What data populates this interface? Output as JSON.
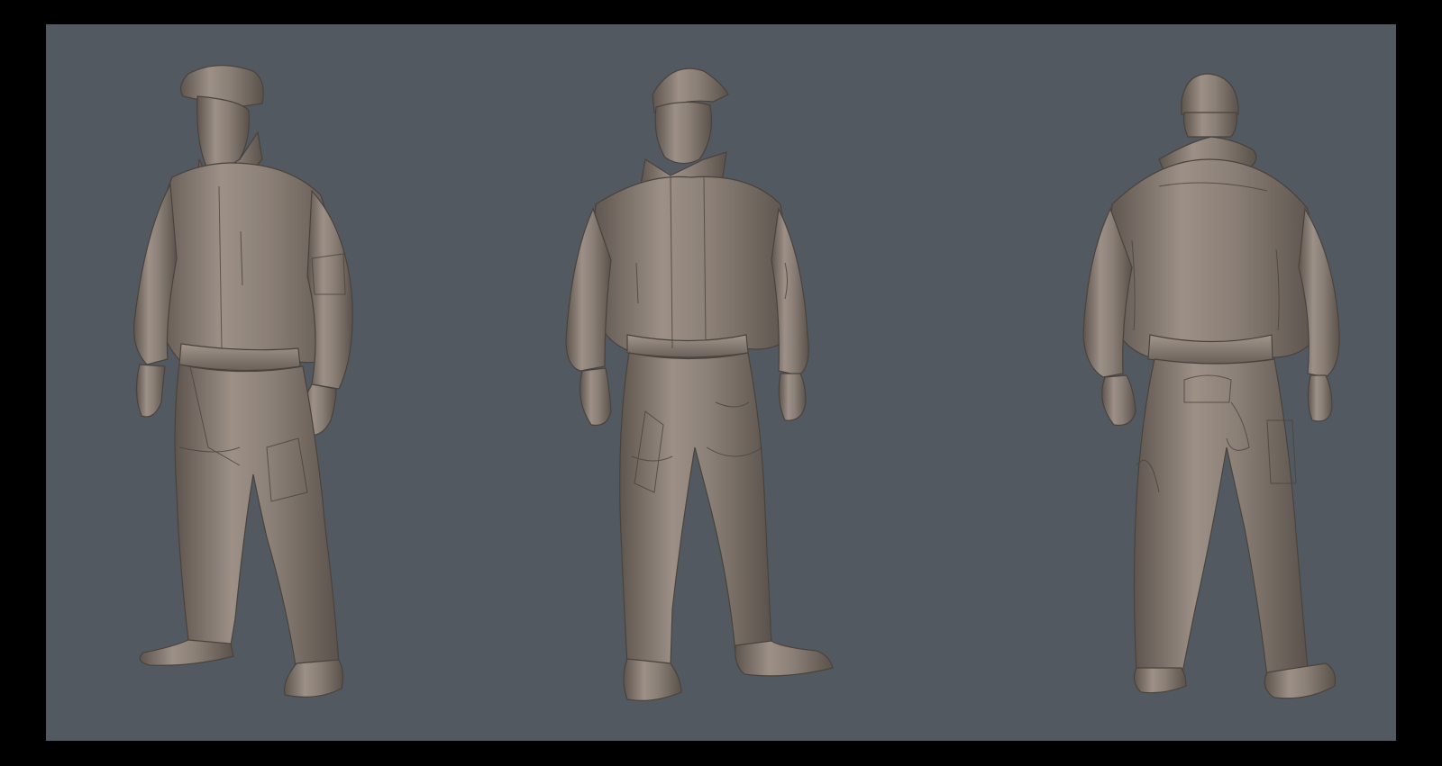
{
  "scene": {
    "background_color": "#525960",
    "frame_color": "#000000",
    "clay_color": "#8a7f76",
    "clay_highlight": "#a89c92",
    "clay_shadow": "#5e554e"
  },
  "figures": [
    {
      "view": "three-quarter-left"
    },
    {
      "view": "front"
    },
    {
      "view": "back"
    }
  ]
}
